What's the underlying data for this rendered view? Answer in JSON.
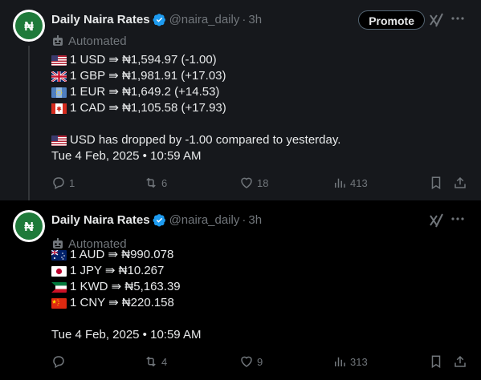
{
  "tweets": [
    {
      "author_name": "Daily Naira Rates",
      "handle": "@naira_daily",
      "separator": "·",
      "time": "3h",
      "promote_label": "Promote",
      "automated_label": "Automated",
      "lines": [
        {
          "flag": "us",
          "text": "1 USD ⇛ ₦1,594.97 (-1.00)"
        },
        {
          "flag": "gb",
          "text": "1 GBP ⇛ ₦1,981.91 (+17.03)"
        },
        {
          "flag": "eu",
          "text": "1 EUR ⇛ ₦1,649.2 (+14.53)"
        },
        {
          "flag": "ca",
          "text": "1 CAD ⇛ ₦1,105.58 (+17.93)"
        }
      ],
      "note": {
        "flag": "us",
        "text": "USD has dropped by -1.00 compared to yesterday."
      },
      "timestamp": "Tue 4 Feb, 2025 • 10:59 AM",
      "replies": "1",
      "reposts": "6",
      "likes": "18",
      "views": "413"
    },
    {
      "author_name": "Daily Naira Rates",
      "handle": "@naira_daily",
      "separator": "·",
      "time": "3h",
      "automated_label": "Automated",
      "lines": [
        {
          "flag": "au",
          "text": "1 AUD ⇛ ₦990.078"
        },
        {
          "flag": "jp",
          "text": "1 JPY ⇛ ₦10.267"
        },
        {
          "flag": "kw",
          "text": "1 KWD ⇛ ₦5,163.39"
        },
        {
          "flag": "cn",
          "text": "1 CNY ⇛ ₦220.158"
        }
      ],
      "timestamp": "Tue 4 Feb, 2025 • 10:59 AM",
      "reposts": "4",
      "likes": "9",
      "views": "313"
    }
  ],
  "colors": {
    "background": "#000000",
    "highlight_background": "#16181c",
    "text": "#e7e9ea",
    "muted": "#71767b",
    "verified": "#1d9bf0",
    "avatar_green": "#1f7a3a"
  }
}
